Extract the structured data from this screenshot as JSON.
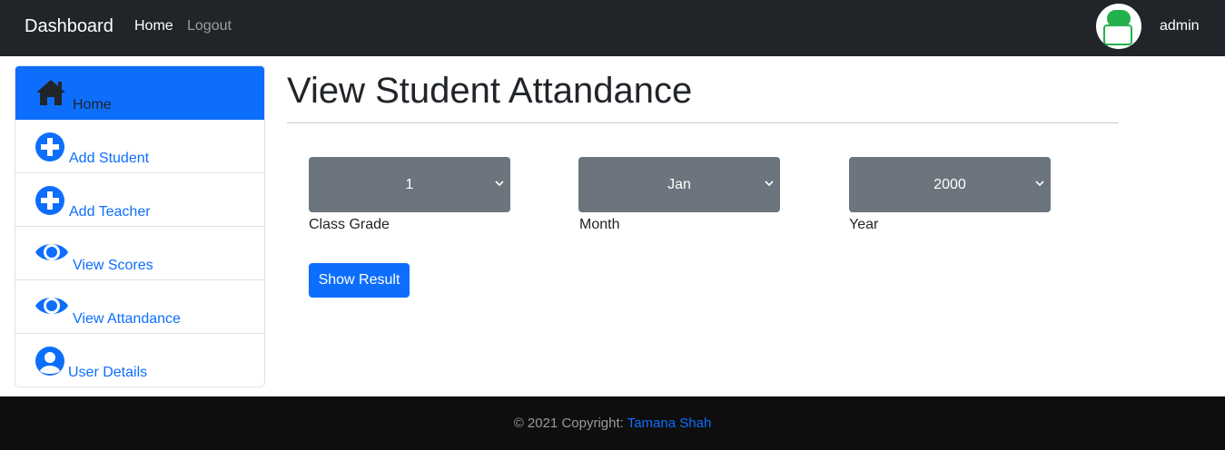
{
  "navbar": {
    "brand": "Dashboard",
    "links": {
      "home": "Home",
      "logout": "Logout"
    },
    "username": "admin",
    "avatar_color": "#22b14c"
  },
  "sidebar": {
    "items": [
      {
        "label": "Home",
        "icon": "home-icon",
        "active": true
      },
      {
        "label": "Add Student",
        "icon": "plus-circle-icon"
      },
      {
        "label": "Add Teacher",
        "icon": "plus-circle-icon"
      },
      {
        "label": "View Scores",
        "icon": "eye-icon"
      },
      {
        "label": "View Attandance",
        "icon": "eye-icon"
      },
      {
        "label": "User Details",
        "icon": "user-circle-icon"
      }
    ]
  },
  "main": {
    "title": "View Student Attandance",
    "filters": {
      "grade": {
        "value": "1",
        "label": "Class Grade"
      },
      "month": {
        "value": "Jan",
        "label": "Month"
      },
      "year": {
        "value": "2000",
        "label": "Year"
      }
    },
    "submit_label": "Show Result"
  },
  "footer": {
    "copyright": "© 2021 Copyright: ",
    "author": "Tamana Shah"
  },
  "colors": {
    "primary": "#0d6efd",
    "navbar_bg": "#212529",
    "select_bg": "#6c757d",
    "footer_bg": "#0e0e0f"
  }
}
